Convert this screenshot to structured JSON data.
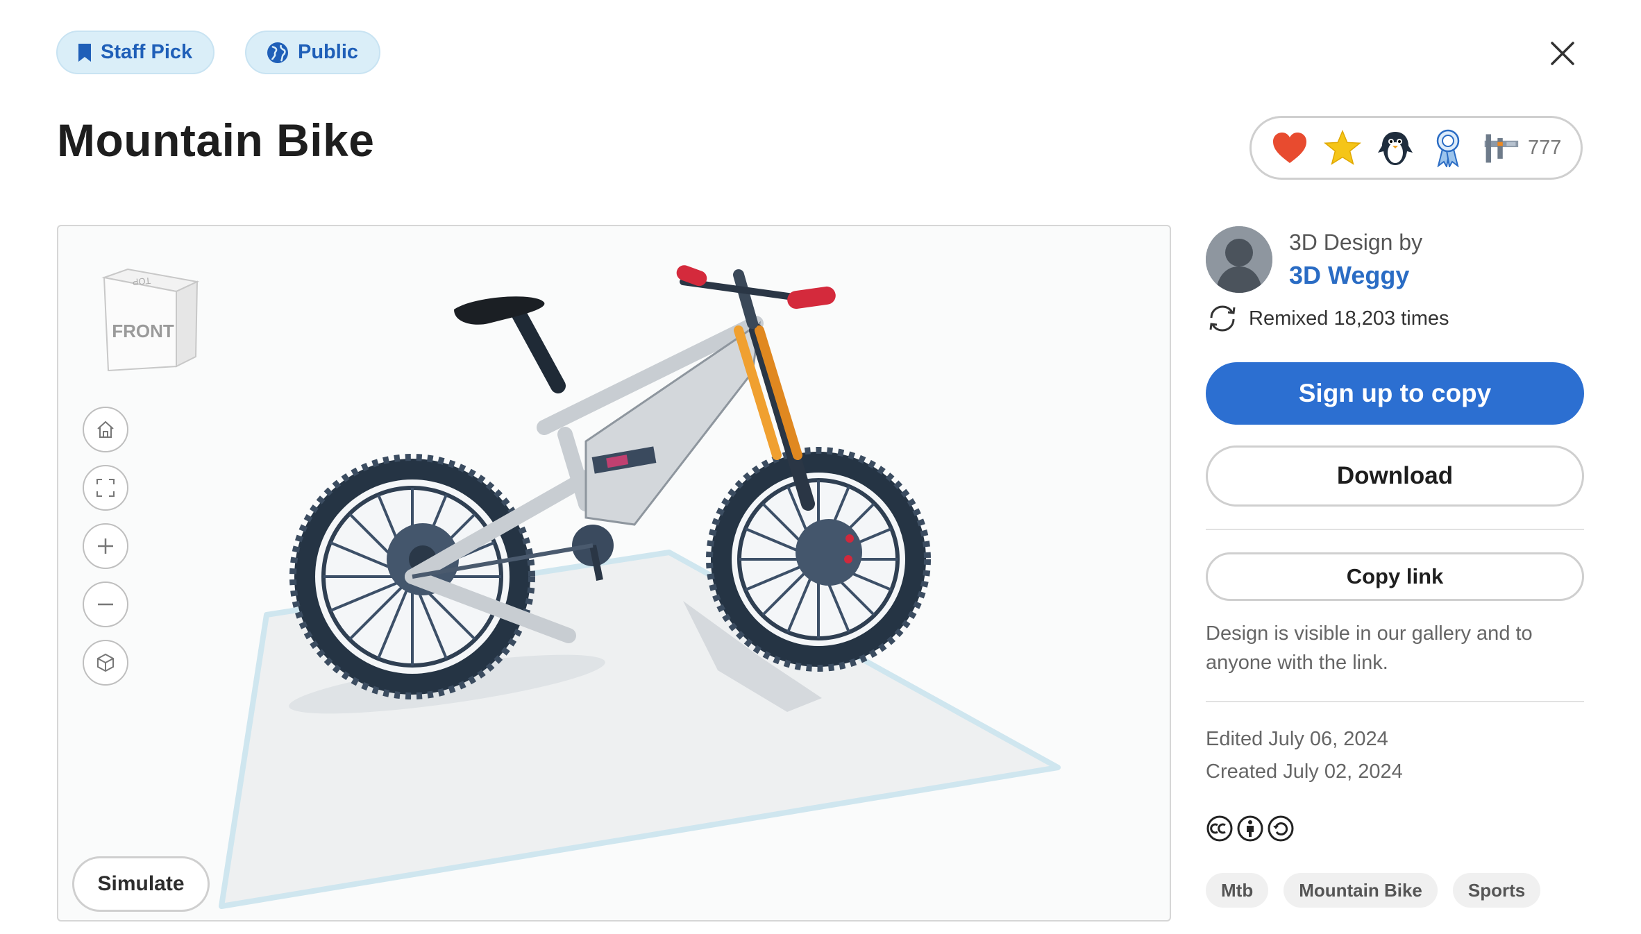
{
  "badges": {
    "staff_pick": "Staff Pick",
    "public": "Public"
  },
  "design": {
    "title": "Mountain Bike"
  },
  "reactions": {
    "icons": [
      "heart-icon",
      "star-icon",
      "penguin-icon",
      "ribbon-icon",
      "caliper-icon"
    ],
    "count": "777"
  },
  "viewer": {
    "viewcube_label": "FRONT",
    "viewcube_top_label": "TOP",
    "simulate_label": "Simulate",
    "controls": [
      "home-icon",
      "fit-view-icon",
      "zoom-in-icon",
      "zoom-out-icon",
      "perspective-icon"
    ]
  },
  "sidebar": {
    "by_label": "3D Design by",
    "author": "3D Weggy",
    "remixed": "Remixed 18,203 times",
    "sign_up": "Sign up to copy",
    "download": "Download",
    "copy_link": "Copy link",
    "visibility_note": "Design is visible in our gallery and to anyone with the link.",
    "edited": "Edited July 06, 2024",
    "created": "Created July 02, 2024",
    "tags": [
      "Mtb",
      "Mountain Bike",
      "Sports"
    ]
  },
  "colors": {
    "primary": "#2c6fd1",
    "badge_bg": "#daeef8",
    "badge_text": "#1f5fb8",
    "link": "#2a6cc4"
  }
}
